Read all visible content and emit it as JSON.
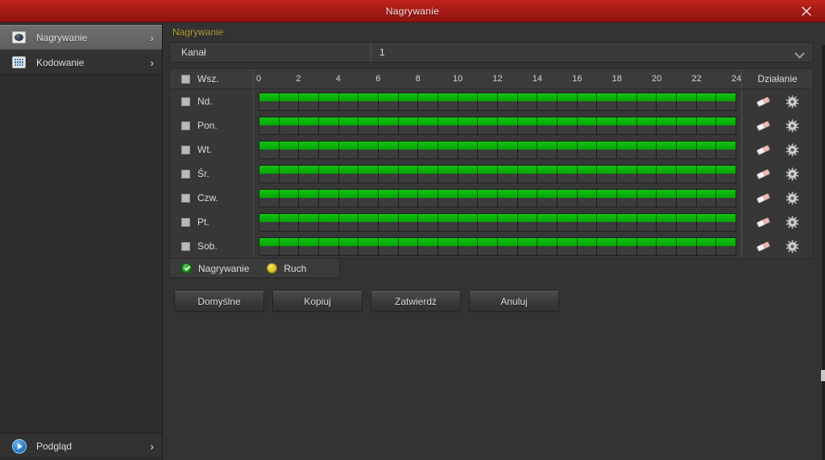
{
  "window": {
    "title": "Nagrywanie",
    "close_icon": "close-icon"
  },
  "sidebar": {
    "items": [
      {
        "label": "Nagrywanie",
        "icon": "disc-icon",
        "chevron": "›",
        "active": true
      },
      {
        "label": "Kodowanie",
        "icon": "grid-icon",
        "chevron": "›",
        "active": false
      }
    ],
    "bottom_item": {
      "label": "Podgląd",
      "icon": "play-icon",
      "chevron": "›"
    }
  },
  "main": {
    "tab_label": "Nagrywanie",
    "channel": {
      "label": "Kanał",
      "value": "1",
      "chevron_icon": "chevron-down-icon"
    },
    "table": {
      "select_all_label": "Wsz.",
      "action_header": "Działanie",
      "time_ticks": [
        "0",
        "2",
        "4",
        "6",
        "8",
        "10",
        "12",
        "14",
        "16",
        "18",
        "20",
        "22",
        "24"
      ],
      "rows": [
        {
          "day": "Nd.",
          "checked": false,
          "record_from": 0,
          "record_to": 24
        },
        {
          "day": "Pon.",
          "checked": false,
          "record_from": 0,
          "record_to": 24
        },
        {
          "day": "Wt.",
          "checked": false,
          "record_from": 0,
          "record_to": 24
        },
        {
          "day": "Śr.",
          "checked": false,
          "record_from": 0,
          "record_to": 24
        },
        {
          "day": "Czw.",
          "checked": false,
          "record_from": 0,
          "record_to": 24
        },
        {
          "day": "Pt.",
          "checked": false,
          "record_from": 0,
          "record_to": 24
        },
        {
          "day": "Sob.",
          "checked": false,
          "record_from": 0,
          "record_to": 24
        }
      ],
      "row_action_icons": [
        "eraser-icon",
        "gear-icon"
      ]
    },
    "legend": [
      {
        "label": "Nagrywanie",
        "type": "rec",
        "color": "#16a016"
      },
      {
        "label": "Ruch",
        "type": "motion",
        "color": "#d9bd1f"
      }
    ],
    "buttons": [
      {
        "label": "Domyślne"
      },
      {
        "label": "Kopiuj"
      },
      {
        "label": "Zatwierdź"
      },
      {
        "label": "Anuluj"
      }
    ]
  },
  "colors": {
    "titlebar": "#a81b16",
    "accent_tab": "#b9a13a",
    "record_green": "#0db00d",
    "panel_bg": "#333333",
    "sidebar_bg": "#2e2e2e"
  }
}
